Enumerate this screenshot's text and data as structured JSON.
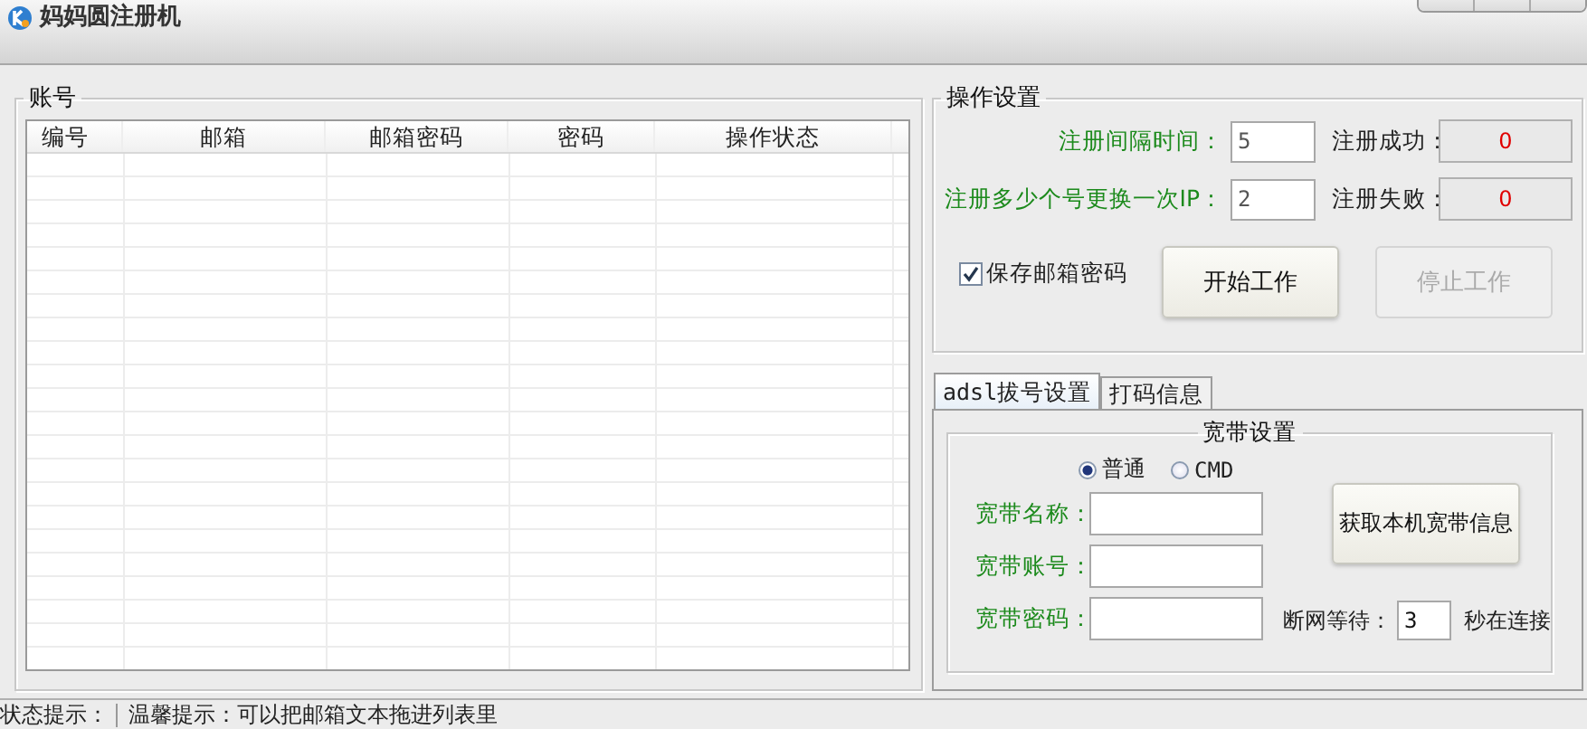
{
  "window": {
    "title": "妈妈圆注册机"
  },
  "accounts": {
    "title": "账号",
    "columns": [
      "编号",
      "邮箱",
      "邮箱密码",
      "密码",
      "操作状态"
    ]
  },
  "operations": {
    "title": "操作设置",
    "fields": [
      {
        "label": "注册间隔时间：",
        "value": "5"
      },
      {
        "label": "注册多少个号更换一次IP：",
        "value": "2"
      }
    ],
    "counters": [
      {
        "label": "注册成功：",
        "value": "0"
      },
      {
        "label": "注册失败：",
        "value": "0"
      }
    ],
    "save_password": {
      "label": "保存邮箱密码",
      "checked": true
    },
    "buttons": [
      {
        "label": "开始工作",
        "disabled": false
      },
      {
        "label": "停止工作",
        "disabled": true
      }
    ]
  },
  "tabs": [
    {
      "label": "adsl拔号设置",
      "selected": true
    },
    {
      "label": "打码信息",
      "selected": false
    }
  ],
  "broadband": {
    "title": "宽带设置",
    "modes": [
      {
        "label": "普通",
        "selected": true
      },
      {
        "label": "CMD",
        "selected": false
      }
    ],
    "fields": [
      {
        "label": "宽带名称："
      },
      {
        "label": "宽带账号："
      },
      {
        "label": "宽带密码："
      }
    ],
    "fetch_button": "获取本机宽带信息",
    "wait": {
      "label": "断网等待：",
      "value": "3",
      "suffix": "秒在连接"
    }
  },
  "status_bar": {
    "label": "状态提示：",
    "message": "温馨提示：可以把邮箱文本拖进列表里"
  }
}
